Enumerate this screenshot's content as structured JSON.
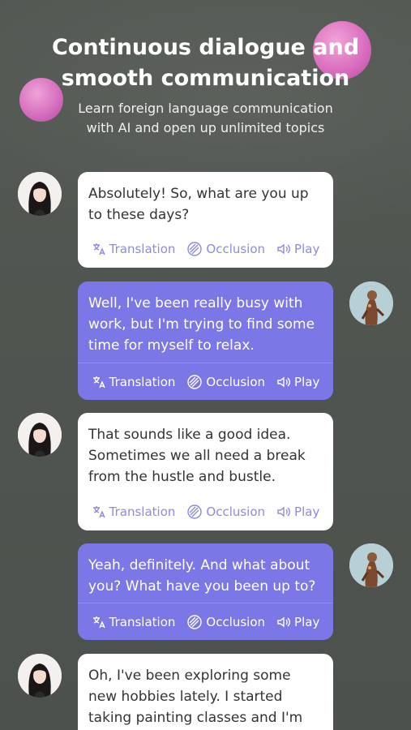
{
  "header": {
    "title_line1": "Continuous dialogue and",
    "title_line2": "smooth communication",
    "subtitle_line1": "Learn foreign language communication",
    "subtitle_line2": "with AI and open up unlimited topics"
  },
  "actions": {
    "translation": "Translation",
    "occlusion": "Occlusion",
    "play": "Play"
  },
  "messages": [
    {
      "sender": "ai",
      "text": "Absolutely! So, what are you up to these days?"
    },
    {
      "sender": "user",
      "text": "Well, I've been really busy with work, but I'm trying to find some time for myself to relax."
    },
    {
      "sender": "ai",
      "text": "That sounds like a good idea. Sometimes we all need a break from the hustle and bustle."
    },
    {
      "sender": "user",
      "text": "Yeah, definitely. And what about you? What have you been up to?"
    },
    {
      "sender": "ai",
      "text": "Oh, I've been exploring some new hobbies lately. I started taking painting classes and I'm"
    }
  ],
  "colors": {
    "background": "#4e534f",
    "user_bubble": "#7c77e6",
    "ai_bubble": "#ffffff",
    "action_accent": "#8f8adf",
    "orb": "#d86bbd"
  }
}
